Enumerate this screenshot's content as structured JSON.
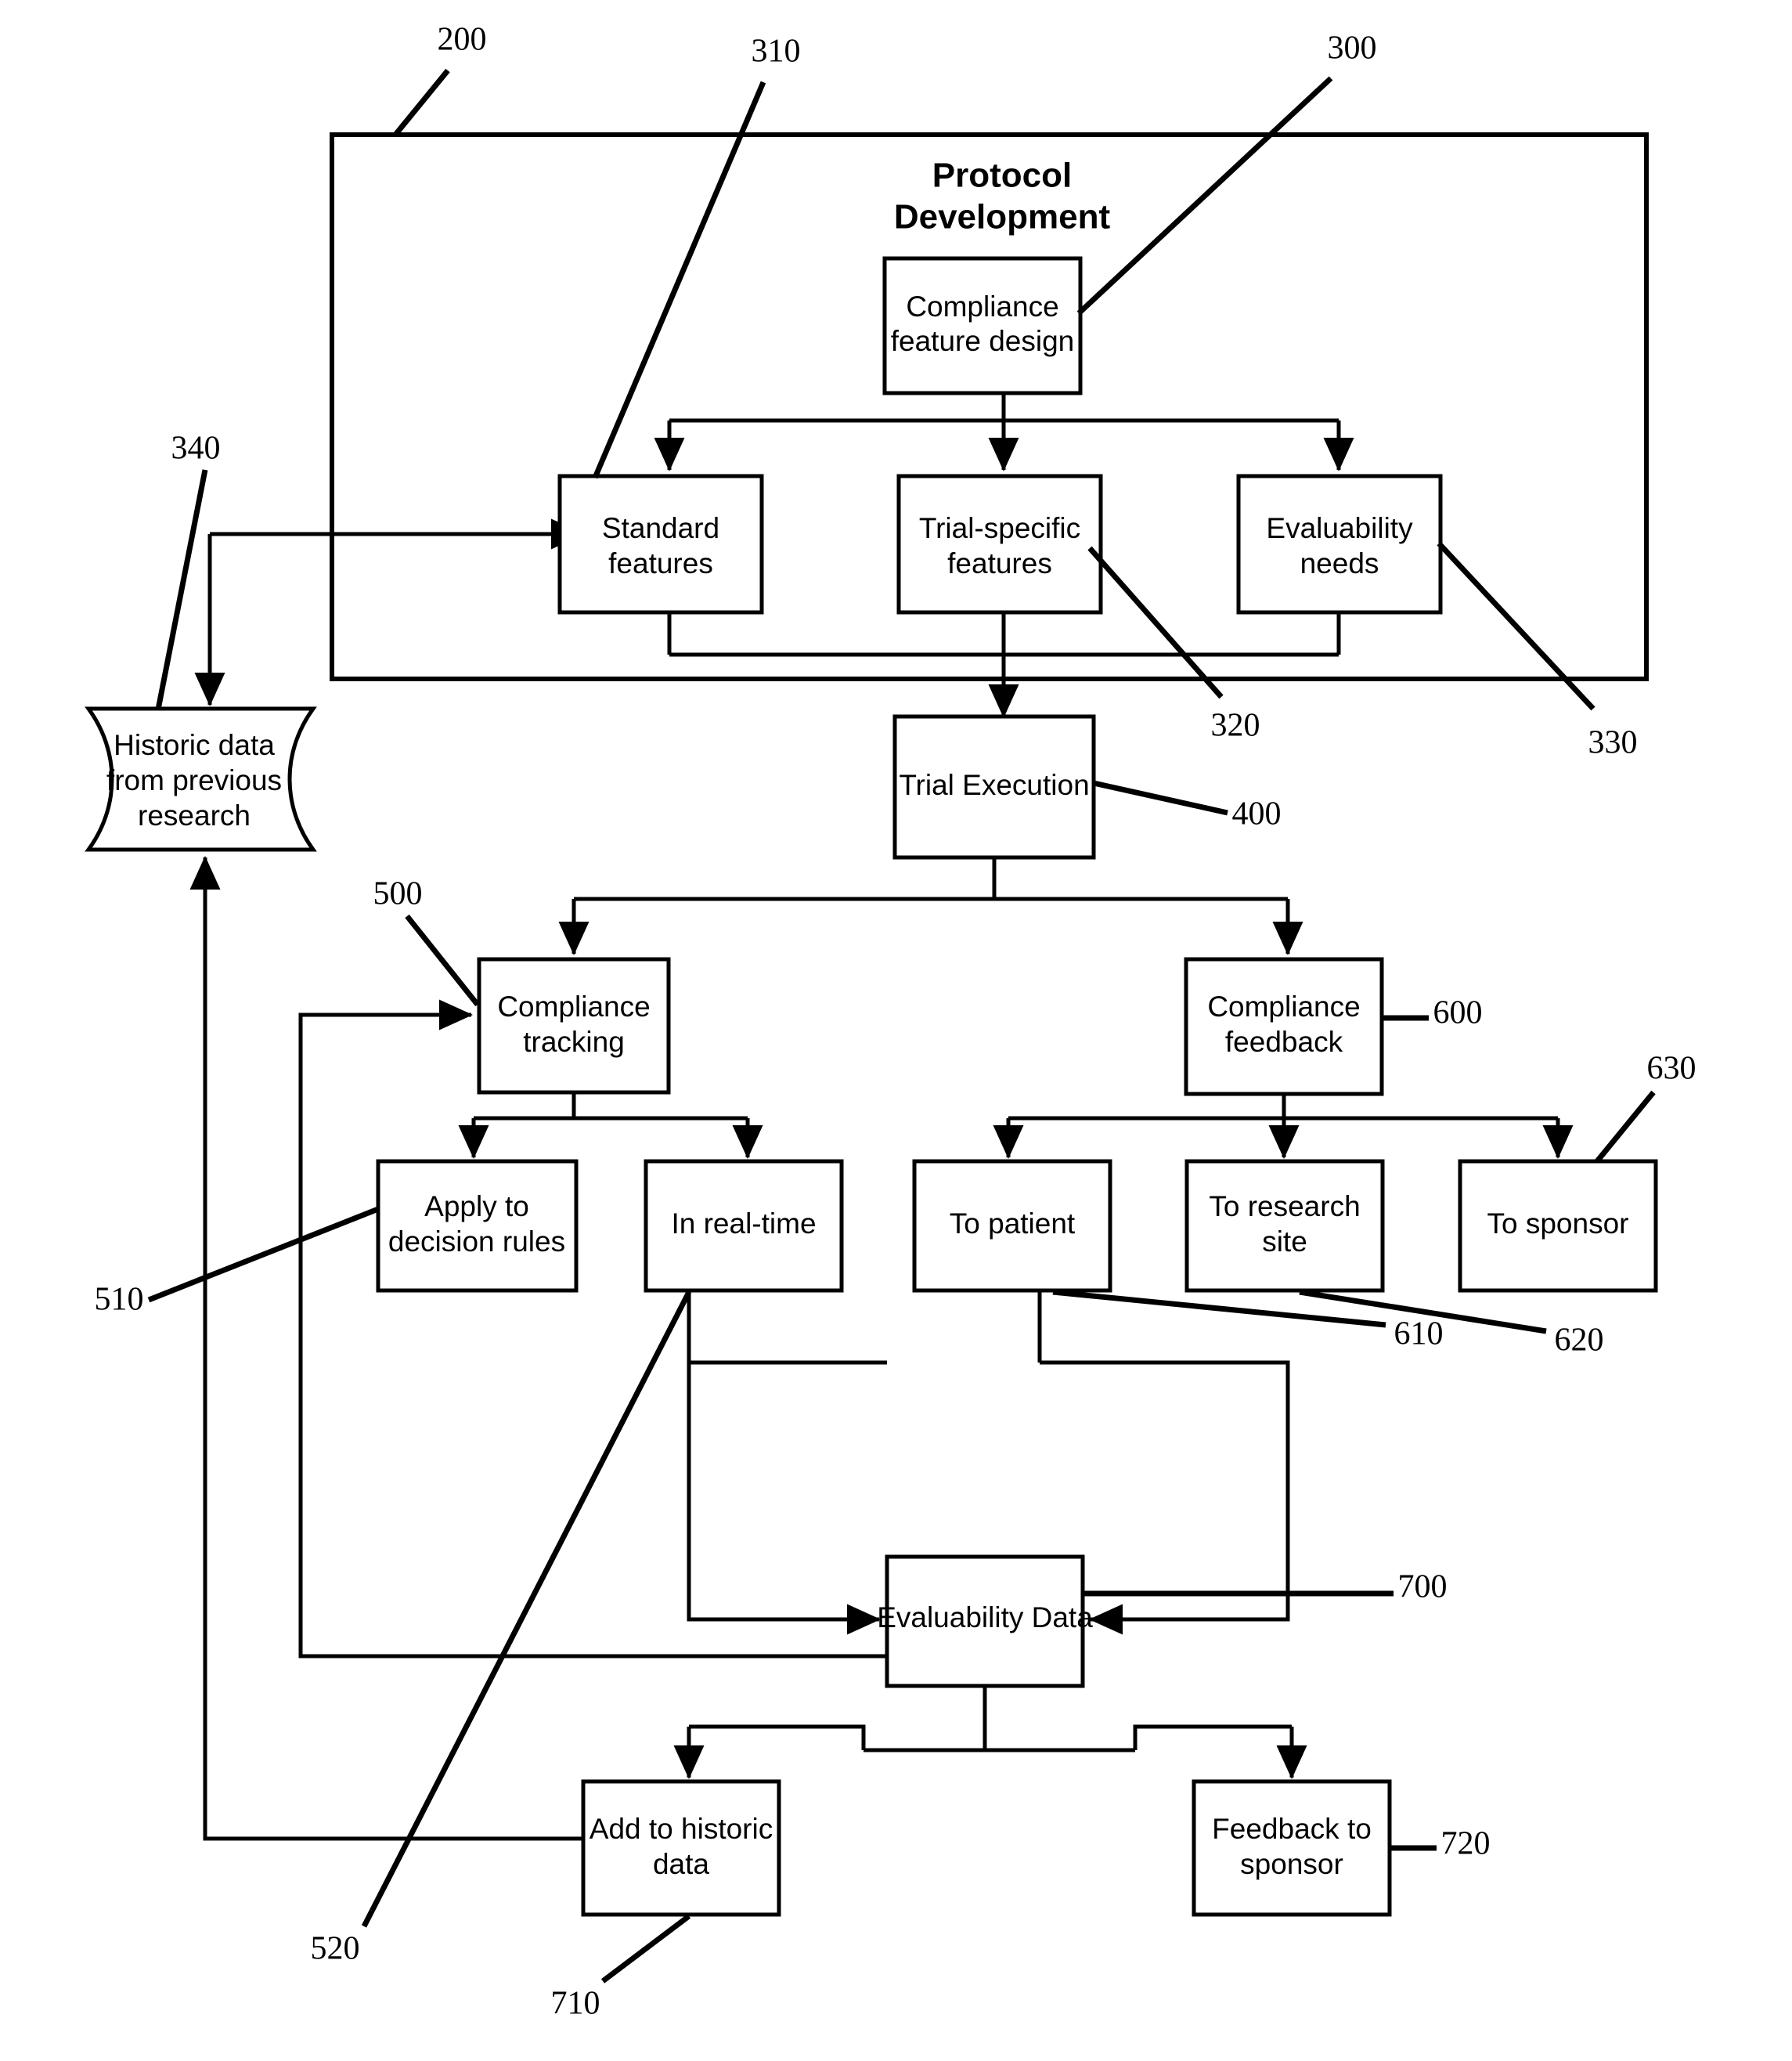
{
  "figure": {
    "type": "patent-flowchart",
    "container": {
      "title_line1": "Protocol",
      "title_line2": "Development",
      "ref": "200"
    },
    "nodes": [
      {
        "id": "compliance_feature_design",
        "line1": "Compliance",
        "line2": "feature design",
        "ref": "300"
      },
      {
        "id": "standard_features",
        "line1": "Standard",
        "line2": "features",
        "ref": "310"
      },
      {
        "id": "trial_specific_features",
        "line1": "Trial-specific",
        "line2": "features",
        "ref": "320"
      },
      {
        "id": "evaluability_needs",
        "line1": "Evaluability",
        "line2": "needs",
        "ref": "330"
      },
      {
        "id": "historic_data",
        "line1": "Historic data",
        "line2": "from previous",
        "line3": "research",
        "ref": "340"
      },
      {
        "id": "trial_execution",
        "line1": "Trial Execution",
        "line2": "",
        "ref": "400"
      },
      {
        "id": "compliance_tracking",
        "line1": "Compliance",
        "line2": "tracking",
        "ref": "500"
      },
      {
        "id": "apply_to_decision_rules",
        "line1": "Apply to",
        "line2": "decision rules",
        "ref": "510"
      },
      {
        "id": "in_real_time",
        "line1": "In real-time",
        "line2": "",
        "ref": "520"
      },
      {
        "id": "compliance_feedback",
        "line1": "Compliance",
        "line2": "feedback",
        "ref": "600"
      },
      {
        "id": "to_patient",
        "line1": "To patient",
        "line2": "",
        "ref": "610"
      },
      {
        "id": "to_research_site",
        "line1": "To research",
        "line2": "site",
        "ref": "620"
      },
      {
        "id": "to_sponsor",
        "line1": "To sponsor",
        "line2": "",
        "ref": "630"
      },
      {
        "id": "evaluability_data",
        "line1": "Evaluability Data",
        "line2": "",
        "ref": "700"
      },
      {
        "id": "add_to_historic_data",
        "line1": "Add to historic",
        "line2": "data",
        "ref": "710"
      },
      {
        "id": "feedback_to_sponsor",
        "line1": "Feedback to",
        "line2": "sponsor",
        "ref": "720"
      }
    ],
    "reference_numerals": [
      "200",
      "300",
      "310",
      "320",
      "330",
      "340",
      "400",
      "500",
      "510",
      "520",
      "600",
      "610",
      "620",
      "630",
      "700",
      "710",
      "720"
    ],
    "colors": {
      "stroke": "#000000",
      "fill": "#ffffff",
      "background": "#ffffff"
    }
  }
}
